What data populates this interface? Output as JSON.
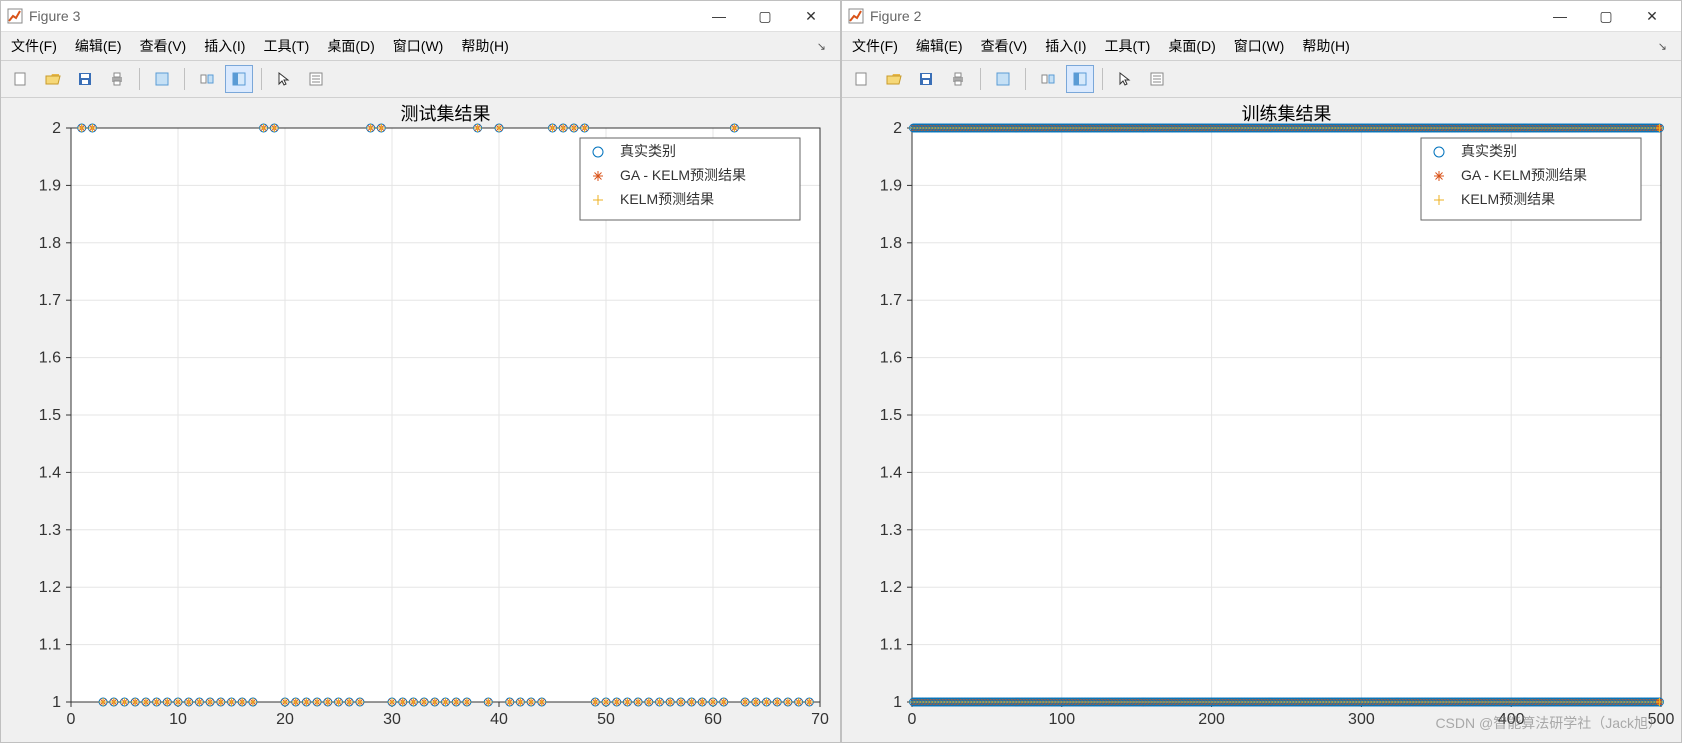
{
  "windows": [
    {
      "title": "Figure 3",
      "menus": [
        "文件(F)",
        "编辑(E)",
        "查看(V)",
        "插入(I)",
        "工具(T)",
        "桌面(D)",
        "窗口(W)",
        "帮助(H)"
      ]
    },
    {
      "title": "Figure 2",
      "menus": [
        "文件(F)",
        "编辑(E)",
        "查看(V)",
        "插入(I)",
        "工具(T)",
        "桌面(D)",
        "窗口(W)",
        "帮助(H)"
      ]
    }
  ],
  "toolbar_icons": [
    "new",
    "open",
    "save",
    "print",
    "|",
    "figure",
    "|",
    "link",
    "dock",
    "|",
    "pointer",
    "inspect"
  ],
  "legend": {
    "entries": [
      {
        "symbol": "circle",
        "color": "#0072BD",
        "label": "真实类别"
      },
      {
        "symbol": "asterisk",
        "color": "#D95319",
        "label": "GA - KELM预测结果"
      },
      {
        "symbol": "plus",
        "color": "#EDB120",
        "label": "KELM预测结果"
      }
    ]
  },
  "watermark": "CSDN @智能算法研学社（Jack旭）",
  "chart_data": [
    {
      "type": "scatter",
      "title": "测试集结果",
      "xlabel": "",
      "ylabel": "",
      "xlim": [
        0,
        70
      ],
      "ylim": [
        1,
        2
      ],
      "xticks": [
        0,
        10,
        20,
        30,
        40,
        50,
        60,
        70
      ],
      "yticks": [
        1,
        1.1,
        1.2,
        1.3,
        1.4,
        1.5,
        1.6,
        1.7,
        1.8,
        1.9,
        2
      ],
      "series": [
        {
          "name": "真实类别",
          "symbol": "circle",
          "color": "#0072BD",
          "x": [
            1,
            2,
            3,
            4,
            5,
            6,
            7,
            8,
            9,
            10,
            11,
            12,
            13,
            14,
            15,
            16,
            17,
            18,
            19,
            20,
            21,
            22,
            23,
            24,
            25,
            26,
            27,
            28,
            29,
            30,
            31,
            32,
            33,
            34,
            35,
            36,
            37,
            38,
            39,
            40,
            41,
            42,
            43,
            44,
            45,
            46,
            47,
            48,
            49,
            50,
            51,
            52,
            53,
            54,
            55,
            56,
            57,
            58,
            59,
            60,
            61,
            62,
            63,
            64,
            65,
            66,
            67,
            68,
            69
          ],
          "y": [
            2,
            2,
            1,
            1,
            1,
            1,
            1,
            1,
            1,
            1,
            1,
            1,
            1,
            1,
            1,
            1,
            1,
            2,
            2,
            1,
            1,
            1,
            1,
            1,
            1,
            1,
            1,
            2,
            2,
            1,
            1,
            1,
            1,
            1,
            1,
            1,
            1,
            2,
            1,
            2,
            1,
            1,
            1,
            1,
            2,
            2,
            2,
            2,
            1,
            1,
            1,
            1,
            1,
            1,
            1,
            1,
            1,
            1,
            1,
            1,
            1,
            2,
            1,
            1,
            1,
            1,
            1,
            1,
            1
          ]
        },
        {
          "name": "GA - KELM预测结果",
          "symbol": "asterisk",
          "color": "#D95319",
          "x": [
            1,
            2,
            3,
            4,
            5,
            6,
            7,
            8,
            9,
            10,
            11,
            12,
            13,
            14,
            15,
            16,
            17,
            18,
            19,
            20,
            21,
            22,
            23,
            24,
            25,
            26,
            27,
            28,
            29,
            30,
            31,
            32,
            33,
            34,
            35,
            36,
            37,
            38,
            39,
            40,
            41,
            42,
            43,
            44,
            45,
            46,
            47,
            48,
            49,
            50,
            51,
            52,
            53,
            54,
            55,
            56,
            57,
            58,
            59,
            60,
            61,
            62,
            63,
            64,
            65,
            66,
            67,
            68,
            69
          ],
          "y": [
            2,
            2,
            1,
            1,
            1,
            1,
            1,
            1,
            1,
            1,
            1,
            1,
            1,
            1,
            1,
            1,
            1,
            2,
            2,
            1,
            1,
            1,
            1,
            1,
            1,
            1,
            1,
            2,
            2,
            1,
            1,
            1,
            1,
            1,
            1,
            1,
            1,
            2,
            1,
            2,
            1,
            1,
            1,
            1,
            2,
            2,
            2,
            2,
            1,
            1,
            1,
            1,
            1,
            1,
            1,
            1,
            1,
            1,
            1,
            1,
            1,
            2,
            1,
            1,
            1,
            1,
            1,
            1,
            1
          ]
        },
        {
          "name": "KELM预测结果",
          "symbol": "plus",
          "color": "#EDB120",
          "x": [
            1,
            2,
            3,
            4,
            5,
            6,
            7,
            8,
            9,
            10,
            11,
            12,
            13,
            14,
            15,
            16,
            17,
            18,
            19,
            20,
            21,
            22,
            23,
            24,
            25,
            26,
            27,
            28,
            29,
            30,
            31,
            32,
            33,
            34,
            35,
            36,
            37,
            38,
            39,
            40,
            41,
            42,
            43,
            44,
            45,
            46,
            47,
            48,
            49,
            50,
            51,
            52,
            53,
            54,
            55,
            56,
            57,
            58,
            59,
            60,
            61,
            62,
            63,
            64,
            65,
            66,
            67,
            68,
            69
          ],
          "y": [
            2,
            2,
            1,
            1,
            1,
            1,
            1,
            1,
            1,
            1,
            1,
            1,
            1,
            1,
            1,
            1,
            1,
            2,
            2,
            1,
            1,
            1,
            1,
            1,
            1,
            1,
            1,
            2,
            2,
            1,
            1,
            1,
            1,
            1,
            1,
            1,
            1,
            2,
            1,
            2,
            1,
            1,
            1,
            1,
            2,
            2,
            2,
            2,
            1,
            1,
            1,
            1,
            1,
            1,
            1,
            1,
            1,
            1,
            1,
            1,
            1,
            2,
            1,
            1,
            1,
            1,
            1,
            1,
            1
          ]
        }
      ]
    },
    {
      "type": "scatter",
      "title": "训练集结果",
      "xlabel": "",
      "ylabel": "",
      "xlim": [
        0,
        500
      ],
      "ylim": [
        1,
        2
      ],
      "xticks": [
        0,
        100,
        200,
        300,
        400,
        500
      ],
      "yticks": [
        1,
        1.1,
        1.2,
        1.3,
        1.4,
        1.5,
        1.6,
        1.7,
        1.8,
        1.9,
        2
      ],
      "dense": true,
      "series": [
        {
          "name": "真实类别",
          "symbol": "circle",
          "color": "#0072BD",
          "count_at_1": 250,
          "count_at_2": 250
        },
        {
          "name": "GA - KELM预测结果",
          "symbol": "asterisk",
          "color": "#D95319",
          "count_at_1": 250,
          "count_at_2": 250
        },
        {
          "name": "KELM预测结果",
          "symbol": "plus",
          "color": "#EDB120",
          "count_at_1": 250,
          "count_at_2": 250
        }
      ]
    }
  ]
}
